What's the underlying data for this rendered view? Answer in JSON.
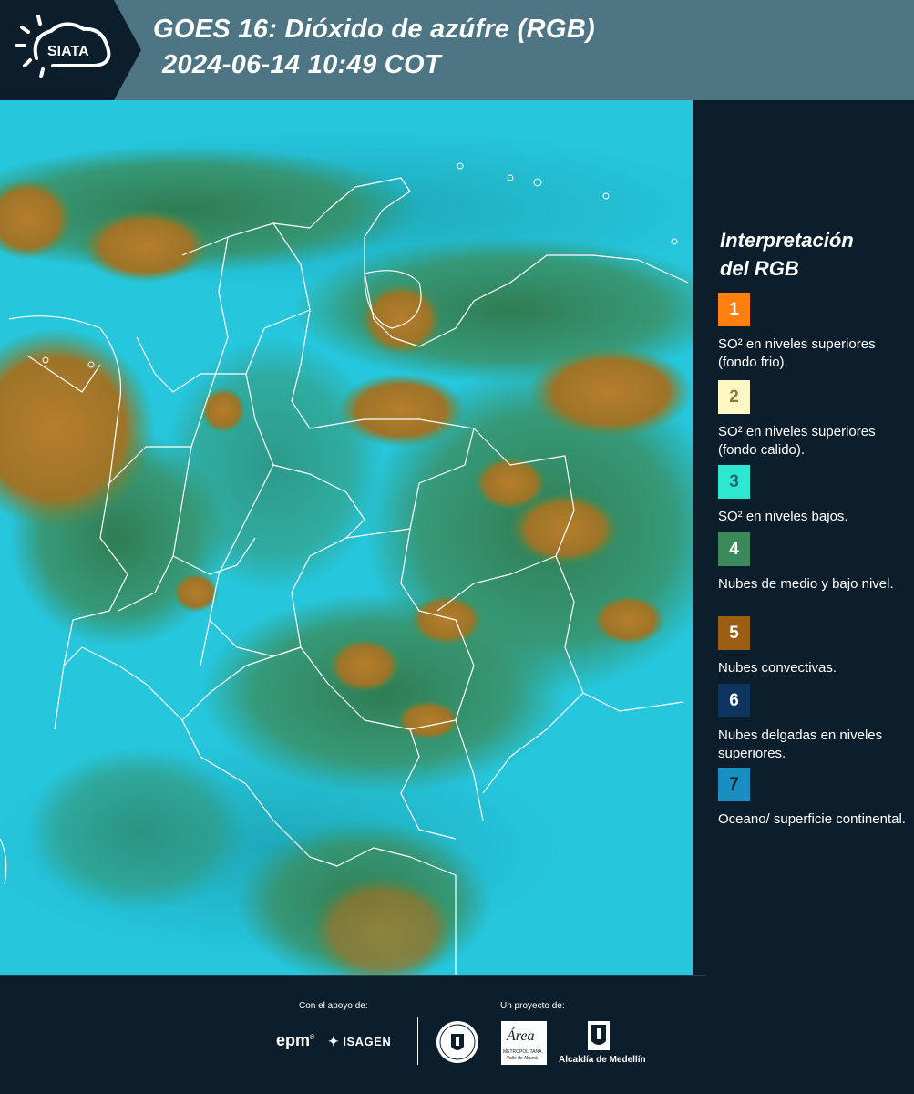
{
  "header": {
    "logo_text": "SIATA",
    "title_line1": "GOES 16: Dióxido de azúfre (RGB)",
    "title_line2": "2024-06-14 10:49 COT"
  },
  "map": {
    "description_icon": "satellite-map"
  },
  "legend": {
    "title_line1": "Interpretación",
    "title_line2": "del RGB",
    "items": [
      {
        "number": "1",
        "color": "#ff7f0f",
        "text_color": "#ffffff",
        "label": "SO² en niveles superiores (fondo frio)."
      },
      {
        "number": "2",
        "color": "#fff8c4",
        "text_color": "#8a7a3a",
        "label": "SO² en niveles superiores (fondo calido)."
      },
      {
        "number": "3",
        "color": "#2de8d0",
        "text_color": "#1e6b66",
        "label": "SO² en niveles bajos."
      },
      {
        "number": "4",
        "color": "#3a8a5c",
        "text_color": "#ffffff",
        "label": "Nubes de medio y bajo nivel."
      },
      {
        "number": "5",
        "color": "#9a5e14",
        "text_color": "#ffffff",
        "label": "Nubes convectivas."
      },
      {
        "number": "6",
        "color": "#0e3560",
        "text_color": "#ffffff",
        "label": "Nubes delgadas en niveles superiores."
      },
      {
        "number": "7",
        "color": "#1a8ec0",
        "text_color": "#0c1e2c",
        "label": "Oceano/ superficie continental."
      }
    ]
  },
  "footer": {
    "support_caption": "Con el apoyo de:",
    "project_caption": "Un proyecto de:",
    "epm": "epm",
    "isagen": "ISAGEN",
    "metropolitana": "METROPOLITANA",
    "metropolitana_sub": "Valle de Aburrá",
    "area": "Área",
    "alcaldia": "Alcaldía de Medellín"
  }
}
